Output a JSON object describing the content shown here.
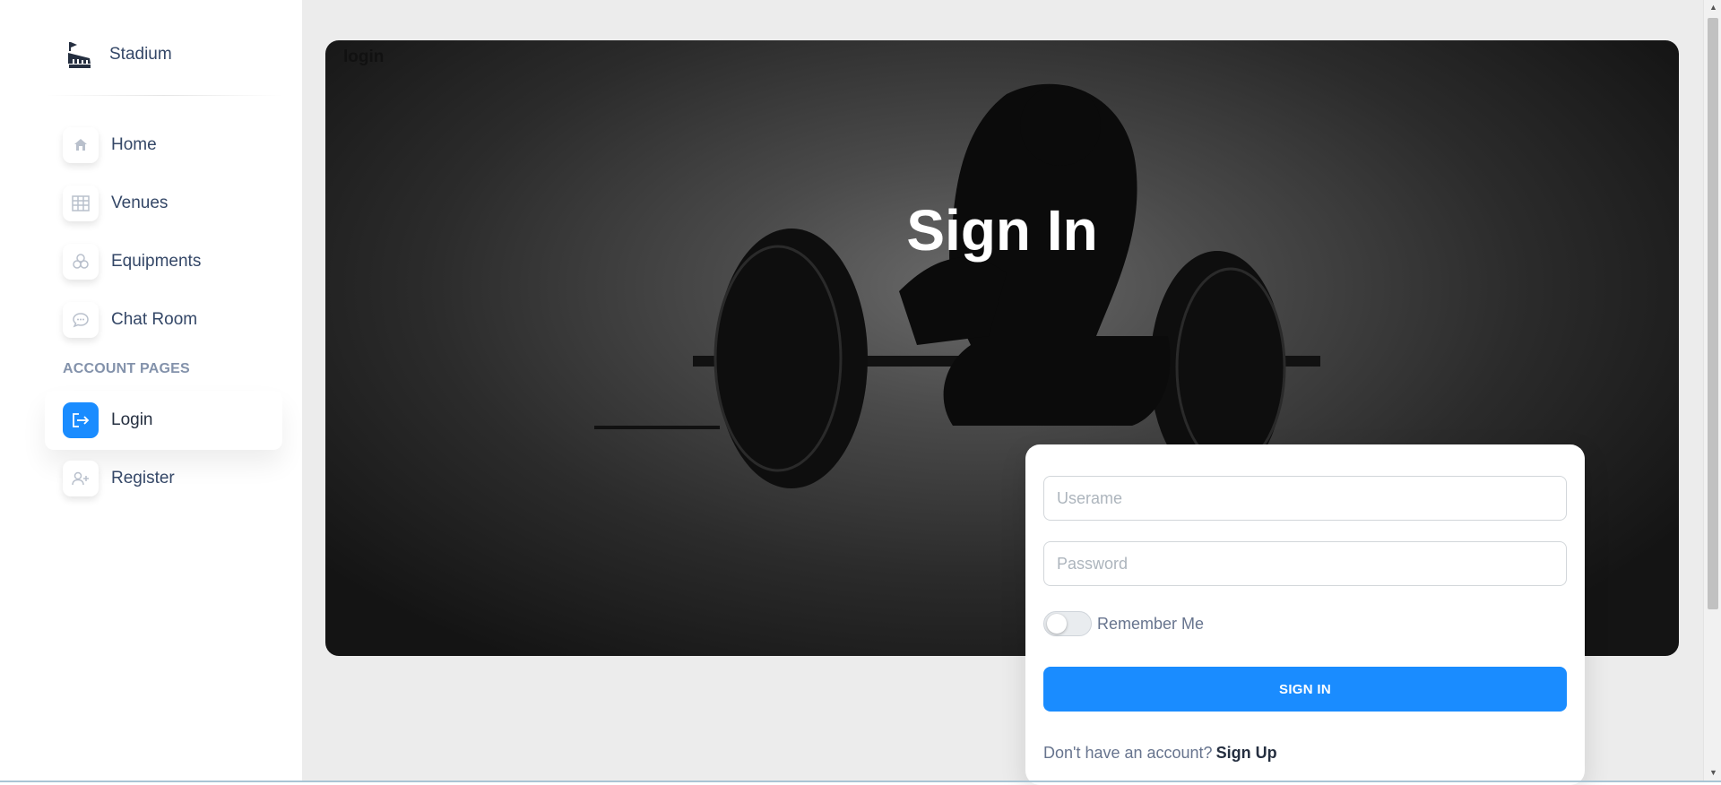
{
  "sidebar": {
    "brand": {
      "name": "Stadium",
      "icon": "stadium-icon"
    },
    "items": [
      {
        "label": "Home",
        "icon": "home-icon"
      },
      {
        "label": "Venues",
        "icon": "table-icon"
      },
      {
        "label": "Equipments",
        "icon": "cubes-icon"
      },
      {
        "label": "Chat Room",
        "icon": "chat-bubble-icon"
      }
    ],
    "section_title": "ACCOUNT PAGES",
    "account_items": [
      {
        "label": "Login",
        "icon": "logout-icon",
        "active": true
      },
      {
        "label": "Register",
        "icon": "add-user-icon",
        "active": false
      }
    ]
  },
  "page": {
    "label": "login"
  },
  "hero": {
    "title": "Sign In"
  },
  "form": {
    "username_placeholder": "Userame",
    "password_placeholder": "Password",
    "remember_label": "Remember Me",
    "remember_checked": false,
    "submit_label": "SIGN IN",
    "signup_prompt": "Don't have an account?",
    "signup_link": "Sign Up"
  },
  "colors": {
    "accent": "#1a8cff",
    "main_bg": "#ececec",
    "text": "#344767",
    "muted": "#8392ab"
  }
}
